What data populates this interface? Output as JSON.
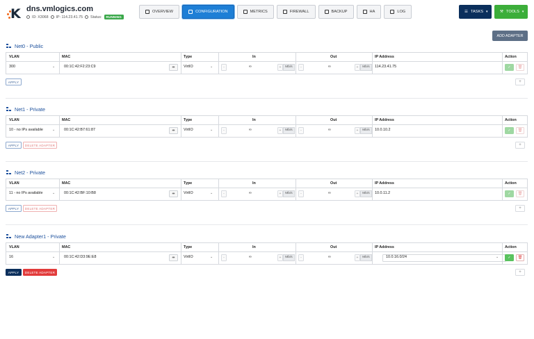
{
  "header": {
    "title": "dns.vmlogics.com",
    "id_text": "ID: X3068",
    "ip_text": "IP: 114.23.41.75",
    "status_label": "Status:",
    "status_badge": "RUNNING"
  },
  "tabs": [
    {
      "label": "OVERVIEW",
      "icon": "document-icon"
    },
    {
      "label": "CONFIGURATION",
      "icon": "config-icon",
      "active": true
    },
    {
      "label": "METRICS",
      "icon": "chart-icon"
    },
    {
      "label": "FIREWALL",
      "icon": "shield-icon"
    },
    {
      "label": "BACKUP",
      "icon": "backup-icon"
    },
    {
      "label": "HA",
      "icon": "ha-icon"
    },
    {
      "label": "LOG",
      "icon": "log-icon"
    }
  ],
  "actions": {
    "tasks": "TASKS",
    "tools": "TOOLS",
    "add_adapter": "ADD ADAPTER"
  },
  "columns": {
    "vlan": "VLAN",
    "mac": "MAC",
    "type": "Type",
    "in": "In",
    "out": "Out",
    "ip": "IP Address",
    "action": "Action"
  },
  "common": {
    "unit": "Mb/s",
    "infinity": "∞",
    "apply": "APPLY",
    "delete_adapter": "DELETE ADAPTER",
    "mac_button": "⇹"
  },
  "adapters": [
    {
      "title": "Net0 - Public",
      "vlan": "300",
      "mac": "00:1C:42:F2:23:C9",
      "type": "VirtIO",
      "ip": "114.23.41.75"
    },
    {
      "title": "Net1 - Private",
      "vlan": "10 - no IPs available",
      "mac": "00:1C:42:B7:61:87",
      "type": "VirtIO",
      "ip": "10.0.10.2"
    },
    {
      "title": "Net2 - Private",
      "vlan": "11 - no IPs available",
      "mac": "00:1C:42:BF:10:B8",
      "type": "VirtIO",
      "ip": "10.0.11.2"
    },
    {
      "title": "New Adapter1 - Private",
      "vlan": "16",
      "mac": "00:1C:42:D3:9E:E8",
      "type": "VirtIO",
      "ip": "10.0.16.0/24"
    }
  ],
  "colors": {
    "accent": "#1e7fd6",
    "navy": "#0b2f5c",
    "green": "#3cae3a",
    "red": "#e23b3b",
    "section_title": "#1b4f9c"
  }
}
